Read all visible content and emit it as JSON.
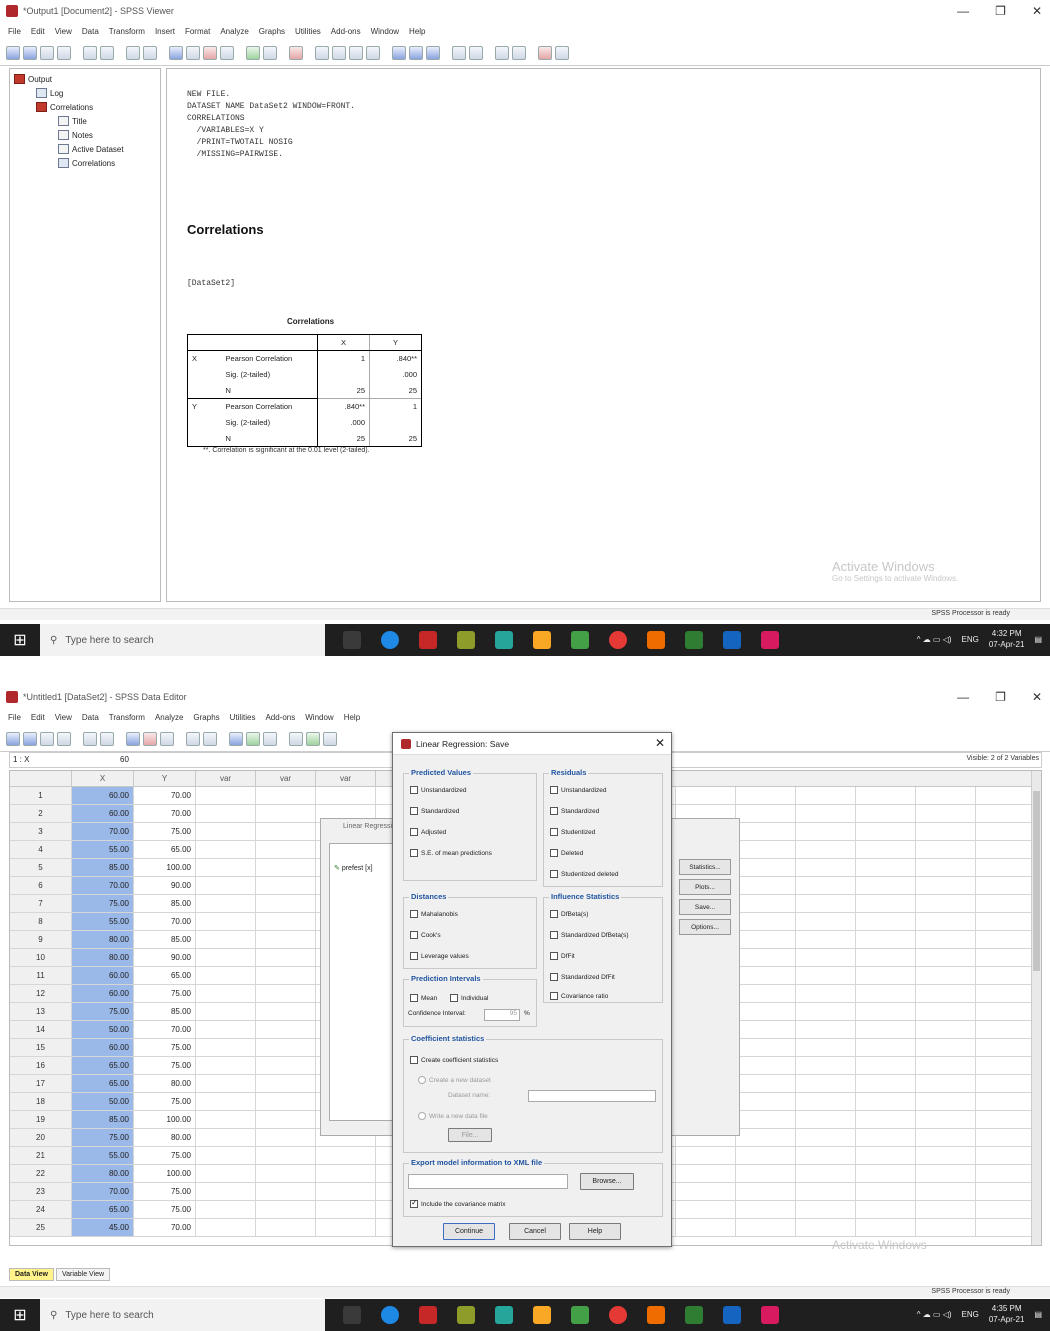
{
  "viewer": {
    "title": "*Output1 [Document2] - SPSS Viewer",
    "menu": [
      "File",
      "Edit",
      "View",
      "Data",
      "Transform",
      "Insert",
      "Format",
      "Analyze",
      "Graphs",
      "Utilities",
      "Add-ons",
      "Window",
      "Help"
    ],
    "tree": [
      "Output",
      "Log",
      "Correlations",
      "Title",
      "Notes",
      "Active Dataset",
      "Correlations"
    ],
    "syntax": "NEW FILE.\nDATASET NAME DataSet2 WINDOW=FRONT.\nCORRELATIONS\n  /VARIABLES=X Y\n  /PRINT=TWOTAIL NOSIG\n  /MISSING=PAIRWISE.",
    "heading": "Correlations",
    "dataset": "[DataSet2]",
    "table": {
      "title": "Correlations",
      "col_x": "X",
      "col_y": "Y",
      "rowx": "X",
      "rowy": "Y",
      "pearson": "Pearson Correlation",
      "sig": "Sig. (2-tailed)",
      "n": "N",
      "xx": "1",
      "xy": ".840**",
      "xy_sig": ".000",
      "n_val": "25",
      "yx": ".840**",
      "yx_sig": ".000",
      "yy": "1",
      "note": "**. Correlation is significant at the 0.01 level (2-tailed)."
    },
    "watermark": "Activate Windows",
    "watermark_sub": "Go to Settings to activate Windows.",
    "status": "SPSS Processor is ready"
  },
  "taskbar": {
    "search_placeholder": "Type here to search",
    "lang": "ENG",
    "time1": "4:32 PM",
    "date1": "07-Apr-21",
    "time2": "4:35 PM",
    "date2": "07-Apr-21",
    "app_colors": [
      "#3a3a3a",
      "#1e88e5",
      "#c62828",
      "#8e9d2a",
      "#26a69a",
      "#f9a825",
      "#43a047",
      "#e53935",
      "#ef6c00",
      "#2e7d32",
      "#1565c0",
      "#d81b60"
    ]
  },
  "editor": {
    "title": "*Untitled1 [DataSet2] - SPSS Data Editor",
    "menu": [
      "File",
      "Edit",
      "View",
      "Data",
      "Transform",
      "Analyze",
      "Graphs",
      "Utilities",
      "Add-ons",
      "Window",
      "Help"
    ],
    "cell_ref": "1 : X",
    "cell_value": "60",
    "visible": "Visible: 2 of 2 Variables",
    "columns": [
      "X",
      "Y",
      "var",
      "var",
      "var"
    ],
    "rows": [
      [
        "60.00",
        "70.00"
      ],
      [
        "60.00",
        "70.00"
      ],
      [
        "70.00",
        "75.00"
      ],
      [
        "55.00",
        "65.00"
      ],
      [
        "85.00",
        "100.00"
      ],
      [
        "70.00",
        "90.00"
      ],
      [
        "75.00",
        "85.00"
      ],
      [
        "55.00",
        "70.00"
      ],
      [
        "80.00",
        "85.00"
      ],
      [
        "80.00",
        "90.00"
      ],
      [
        "60.00",
        "65.00"
      ],
      [
        "60.00",
        "75.00"
      ],
      [
        "75.00",
        "85.00"
      ],
      [
        "50.00",
        "70.00"
      ],
      [
        "60.00",
        "75.00"
      ],
      [
        "65.00",
        "75.00"
      ],
      [
        "65.00",
        "80.00"
      ],
      [
        "50.00",
        "75.00"
      ],
      [
        "85.00",
        "100.00"
      ],
      [
        "75.00",
        "80.00"
      ],
      [
        "55.00",
        "75.00"
      ],
      [
        "80.00",
        "100.00"
      ],
      [
        "70.00",
        "75.00"
      ],
      [
        "65.00",
        "75.00"
      ],
      [
        "45.00",
        "70.00"
      ]
    ],
    "tab_data": "Data View",
    "tab_var": "Variable View",
    "status": "SPSS Processor is ready",
    "bg_dialog": {
      "title": "Linear Regression",
      "list_item": "prefest [x]",
      "buttons": [
        "Statistics...",
        "Plots...",
        "Save...",
        "Options..."
      ]
    }
  },
  "dialog": {
    "title": "Linear Regression: Save",
    "predicted": {
      "label": "Predicted Values",
      "items": [
        "Unstandardized",
        "Standardized",
        "Adjusted",
        "S.E. of mean predictions"
      ]
    },
    "residuals": {
      "label": "Residuals",
      "items": [
        "Unstandardized",
        "Standardized",
        "Studentized",
        "Deleted",
        "Studentized deleted"
      ]
    },
    "distances": {
      "label": "Distances",
      "items": [
        "Mahalanobis",
        "Cook's",
        "Leverage values"
      ]
    },
    "influence": {
      "label": "Influence Statistics",
      "items": [
        "DfBeta(s)",
        "Standardized DfBeta(s)",
        "DfFit",
        "Standardized DfFit",
        "Covariance ratio"
      ]
    },
    "intervals": {
      "label": "Prediction Intervals",
      "mean": "Mean",
      "individual": "Individual",
      "confidence": "Confidence Interval:",
      "confidence_value": "95",
      "percent": "%"
    },
    "coef": {
      "label": "Coefficient statistics",
      "create": "Create coefficient statistics",
      "new_dataset": "Create a new dataset",
      "dataset_name": "Dataset name:",
      "write_file": "Write a new data file",
      "file_btn": "File..."
    },
    "export": {
      "label": "Export model information to XML file",
      "browse": "Browse...",
      "include": "Include the covariance matrix"
    },
    "buttons": {
      "continue": "Continue",
      "cancel": "Cancel",
      "help": "Help"
    }
  }
}
